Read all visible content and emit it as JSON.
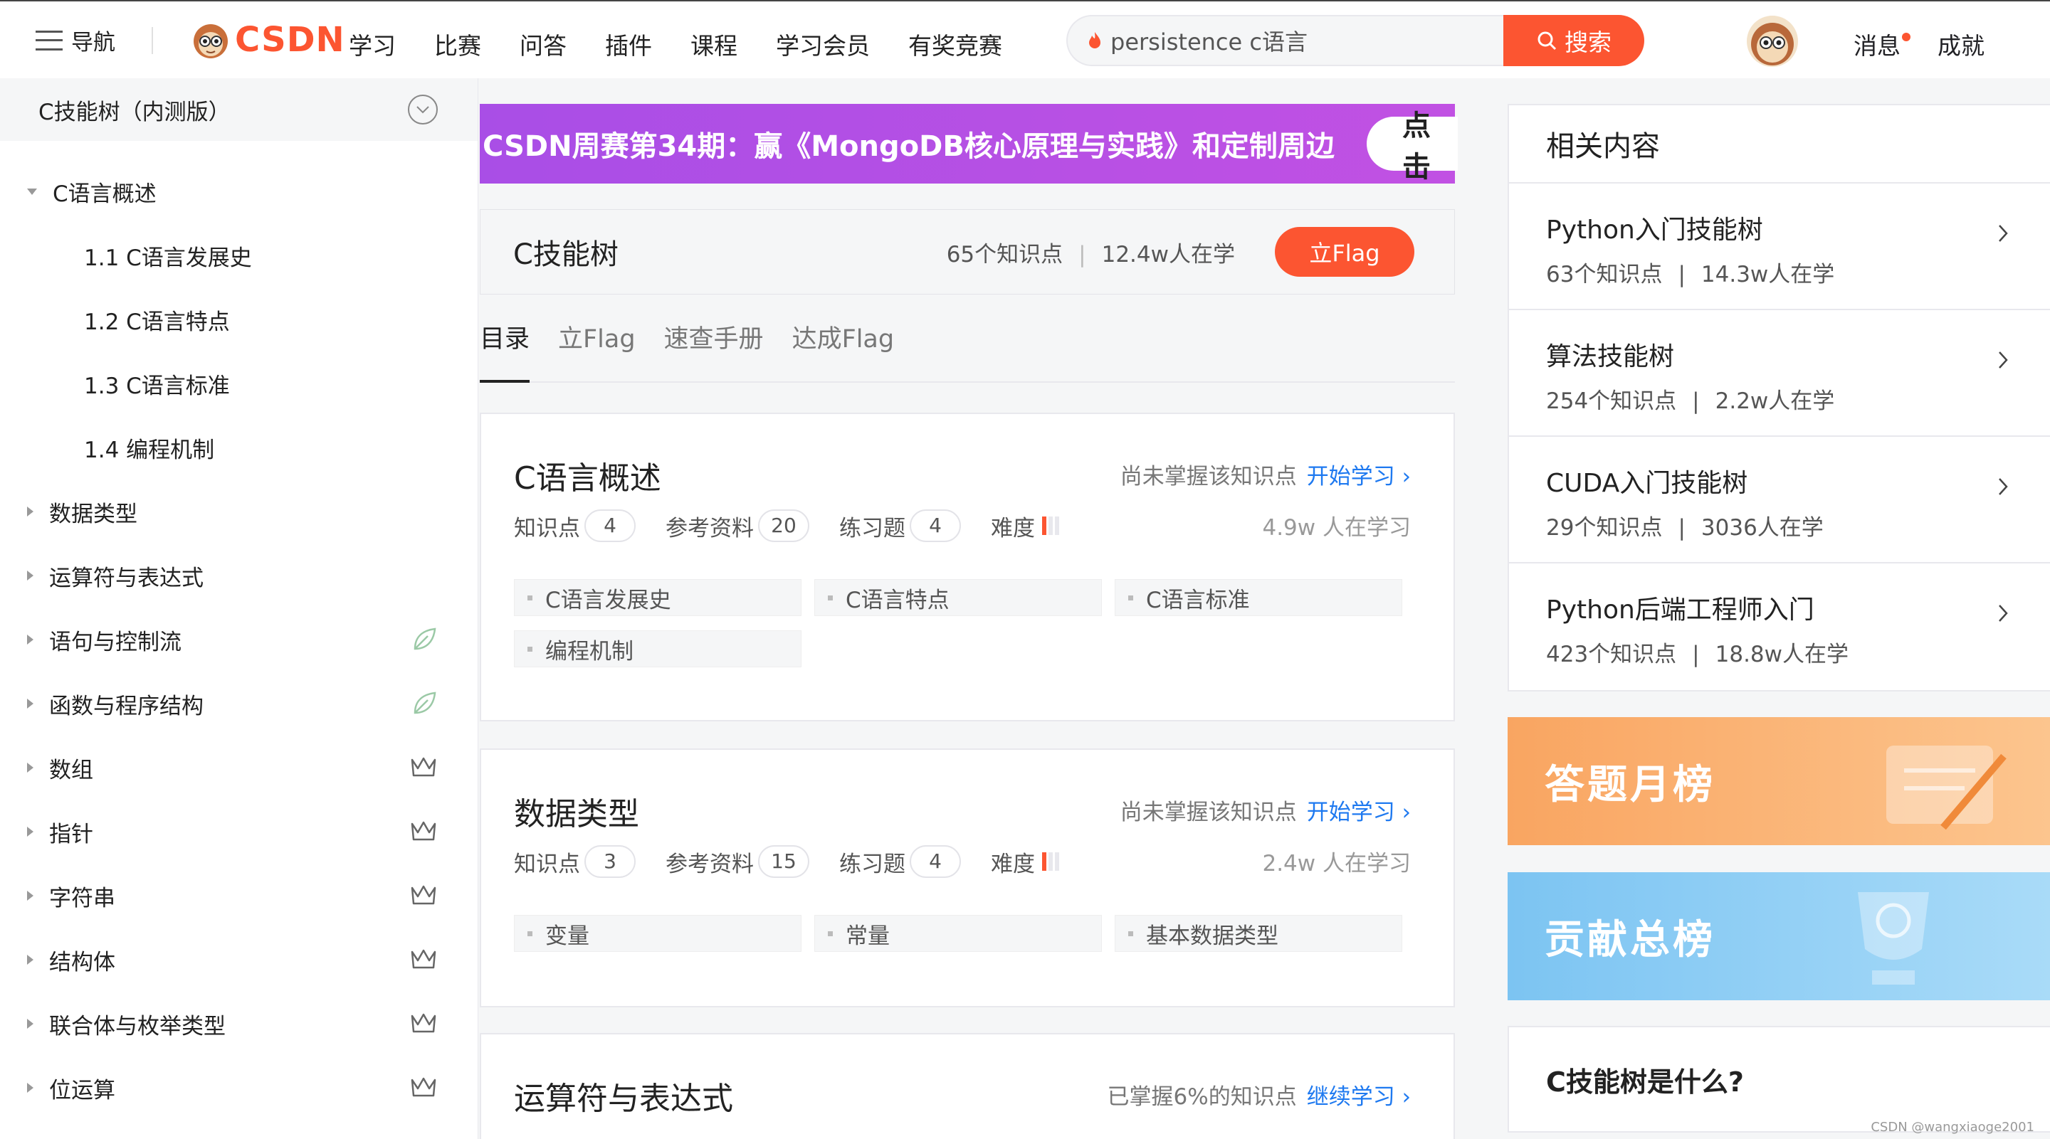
{
  "header": {
    "nav_label": "导航",
    "logo_text": "CSDN",
    "nav_items": [
      "学习",
      "比赛",
      "问答",
      "插件",
      "课程",
      "学习会员",
      "有奖竞赛"
    ],
    "search_value": "persistence c语言",
    "search_button": "搜索",
    "messages": "消息",
    "achievements": "成就"
  },
  "sidebar": {
    "title": "C技能树（内测版）",
    "items": [
      {
        "label": "C语言概述",
        "expanded": true,
        "icon": ""
      },
      {
        "label": "1.1 C语言发展史",
        "sub": true
      },
      {
        "label": "1.2 C语言特点",
        "sub": true
      },
      {
        "label": "1.3 C语言标准",
        "sub": true
      },
      {
        "label": "1.4 编程机制",
        "sub": true
      },
      {
        "label": "数据类型",
        "icon": ""
      },
      {
        "label": "运算符与表达式",
        "icon": ""
      },
      {
        "label": "语句与控制流",
        "icon": "leaf-icon"
      },
      {
        "label": "函数与程序结构",
        "icon": "leaf-icon"
      },
      {
        "label": "数组",
        "icon": "crown-icon"
      },
      {
        "label": "指针",
        "icon": "crown-icon"
      },
      {
        "label": "字符串",
        "icon": "crown-icon"
      },
      {
        "label": "结构体",
        "icon": "crown-icon"
      },
      {
        "label": "联合体与枚举类型",
        "icon": "crown-icon"
      },
      {
        "label": "位运算",
        "icon": "crown-icon"
      }
    ]
  },
  "banner": {
    "text": "CSDN周赛第34期：赢《MongoDB核心原理与实践》和定制周边",
    "button": "点击"
  },
  "skill": {
    "title": "C技能树",
    "knowledge": "65个知识点",
    "learners": "12.4w人在学",
    "flag_button": "立Flag"
  },
  "tabs": [
    "目录",
    "立Flag",
    "速查手册",
    "达成Flag"
  ],
  "cards": [
    {
      "title": "C语言概述",
      "status": "尚未掌握该知识点",
      "action": "开始学习",
      "knowledge_label": "知识点",
      "knowledge_count": "4",
      "refs_label": "参考资料",
      "refs_count": "20",
      "exercises_label": "练习题",
      "exercises_count": "4",
      "difficulty_label": "难度",
      "learners": "4.9w 人在学习",
      "chips": [
        "C语言发展史",
        "C语言特点",
        "C语言标准",
        "编程机制"
      ]
    },
    {
      "title": "数据类型",
      "status": "尚未掌握该知识点",
      "action": "开始学习",
      "knowledge_label": "知识点",
      "knowledge_count": "3",
      "refs_label": "参考资料",
      "refs_count": "15",
      "exercises_label": "练习题",
      "exercises_count": "4",
      "difficulty_label": "难度",
      "learners": "2.4w 人在学习",
      "chips": [
        "变量",
        "常量",
        "基本数据类型"
      ]
    },
    {
      "title": "运算符与表达式",
      "status": "已掌握6%的知识点",
      "action": "继续学习"
    }
  ],
  "related": {
    "title": "相关内容",
    "items": [
      {
        "name": "Python入门技能树",
        "knowledge": "63个知识点",
        "learners": "14.3w人在学"
      },
      {
        "name": "算法技能树",
        "knowledge": "254个知识点",
        "learners": "2.2w人在学"
      },
      {
        "name": "CUDA入门技能树",
        "knowledge": "29个知识点",
        "learners": "3036人在学"
      },
      {
        "name": "Python后端工程师入门",
        "knowledge": "423个知识点",
        "learners": "18.8w人在学"
      }
    ]
  },
  "boards": {
    "answer": "答题月榜",
    "contribution": "贡献总榜"
  },
  "whatis": "C技能树是什么?",
  "watermark": "CSDN @wangxiaoge2001",
  "colors": {
    "accent": "#fc5531",
    "link": "#1e79f0",
    "banner": "#b64ae6"
  }
}
